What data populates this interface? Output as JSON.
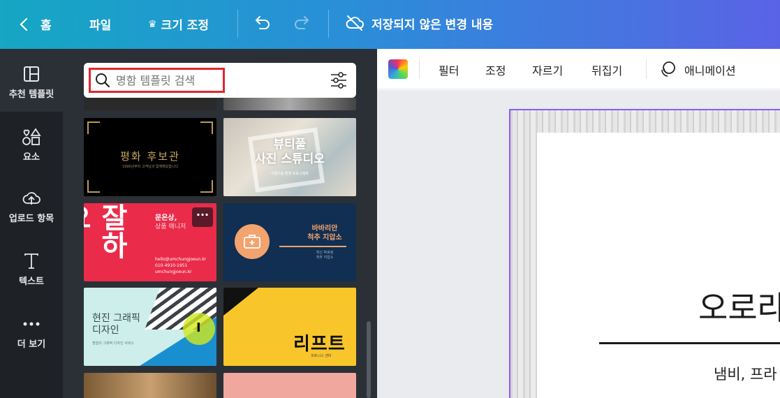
{
  "topbar": {
    "home": "홈",
    "file": "파일",
    "resize": "크기 조정",
    "save_status": "저장되지 않은 변경 내용"
  },
  "rail": {
    "items": [
      {
        "label": "추천 템플릿",
        "icon": "template-icon"
      },
      {
        "label": "요소",
        "icon": "elements-icon"
      },
      {
        "label": "업로드 항목",
        "icon": "upload-cloud-icon"
      },
      {
        "label": "텍스트",
        "icon": "text-icon"
      },
      {
        "label": "더 보기",
        "icon": "more-dots-icon"
      }
    ]
  },
  "panel": {
    "search_placeholder": "명함 템플릿 검색",
    "templates": {
      "t1": {
        "title": "평화 후보관",
        "sub": "1990년부터 고객님과 함께해왔습니다"
      },
      "t2": {
        "title1": "뷰티풀",
        "title2": "사진 스튜디오",
        "sub": "아름다움 촬영 포토그래퍼"
      },
      "t3": {
        "big": "잘하요.",
        "name": "문은상,",
        "role": "상품 매니저",
        "email": "hello@umchungjoeun.kr",
        "phone": "010-4910-1951",
        "web": "umchungjoeun.kr",
        "more": "···"
      },
      "t4": {
        "title1": "바바리안",
        "title2": "척추 지압소",
        "sub1": "척신 박호정",
        "sub2": "척추 지압소"
      },
      "t5": {
        "title1": "현진 그래픽",
        "title2": "디자인",
        "sub": "명함의 그래픽 디자인 서비스"
      },
      "t6": {
        "title": "리프트",
        "sub": "피트니스 센터"
      }
    }
  },
  "toolbar": {
    "filter": "필터",
    "adjust": "조정",
    "crop": "자르기",
    "flip": "뒤집기",
    "animate": "애니메이션"
  },
  "canvas": {
    "title": "오로라",
    "subtitle": "냄비, 프라"
  },
  "colors": {
    "accent_selection": "#8b5cf6",
    "search_highlight": "#e0262e",
    "rail_bg": "#1e2227",
    "panel_bg": "#2b3036"
  }
}
